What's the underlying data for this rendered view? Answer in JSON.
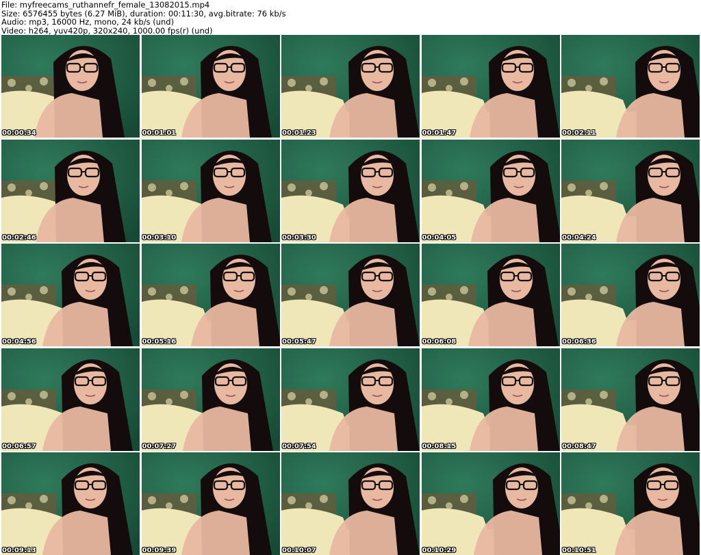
{
  "header": {
    "file_line": "File: myfreecams_ruthannefr_female_13082015.mp4",
    "size_line": "Size: 6576455 bytes (6.27 MiB), duration: 00:11:30, avg.bitrate: 76 kb/s",
    "audio_line": "Audio: mp3, 16000 Hz, mono, 24 kb/s (und)",
    "video_line": "Video: h264, yuv420p, 320x240, 1000.00 fps(r) (und)"
  },
  "colors": {
    "wall": "#2f7a5c",
    "wall_dark": "#174a35",
    "bedding": "#efe7b8",
    "pattern": "#6b5a3a",
    "skin": "#e8b8a0",
    "hair": "#140c0c",
    "timestamp": "#ffffff"
  },
  "thumbnails": [
    {
      "timestamp": "00:00:34"
    },
    {
      "timestamp": "00:01:01"
    },
    {
      "timestamp": "00:01:23"
    },
    {
      "timestamp": "00:01:47"
    },
    {
      "timestamp": "00:02:11"
    },
    {
      "timestamp": "00:02:46"
    },
    {
      "timestamp": "00:03:10"
    },
    {
      "timestamp": "00:03:30"
    },
    {
      "timestamp": "00:04:05"
    },
    {
      "timestamp": "00:04:24"
    },
    {
      "timestamp": "00:04:56"
    },
    {
      "timestamp": "00:05:16"
    },
    {
      "timestamp": "00:05:47"
    },
    {
      "timestamp": "00:06:08"
    },
    {
      "timestamp": "00:06:36"
    },
    {
      "timestamp": "00:06:57"
    },
    {
      "timestamp": "00:07:27"
    },
    {
      "timestamp": "00:07:54"
    },
    {
      "timestamp": "00:08:15"
    },
    {
      "timestamp": "00:08:47"
    },
    {
      "timestamp": "00:09:13"
    },
    {
      "timestamp": "00:09:39"
    },
    {
      "timestamp": "00:10:07"
    },
    {
      "timestamp": "00:10:29"
    },
    {
      "timestamp": "00:10:51"
    }
  ]
}
